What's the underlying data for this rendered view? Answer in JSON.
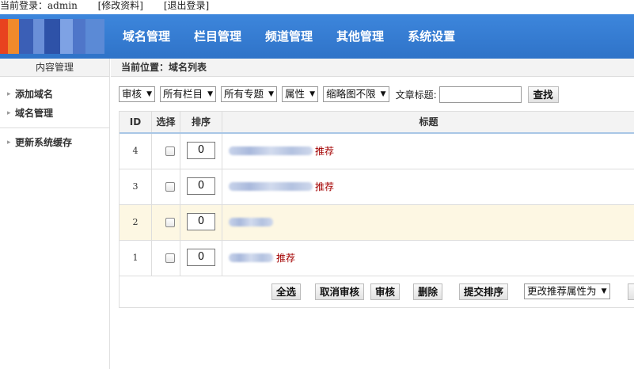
{
  "topbar": {
    "login_label": "当前登录：",
    "username": "admin",
    "edit_profile": "[修改资料]",
    "logout": "[退出登录]"
  },
  "nav": [
    {
      "label": "域名管理"
    },
    {
      "label": "栏目管理"
    },
    {
      "label": "频道管理"
    },
    {
      "label": "其他管理"
    },
    {
      "label": "系统设置"
    }
  ],
  "sidebar": {
    "title": "内容管理",
    "items": [
      {
        "label": "添加域名"
      },
      {
        "label": "域名管理"
      },
      {
        "label": "更新系统缓存"
      }
    ]
  },
  "breadcrumb": {
    "label": "当前位置：",
    "current": "域名列表"
  },
  "filters": {
    "status": "审核",
    "category": "所有栏目",
    "topic": "所有专题",
    "attribute": "属性",
    "thumbnail": "缩略图不限",
    "title_label": "文章标题:",
    "search_value": "",
    "search_button": "查找"
  },
  "table": {
    "headers": {
      "id": "ID",
      "select": "选择",
      "order": "排序",
      "title": "标题"
    },
    "rows": [
      {
        "id": "4",
        "order": "0",
        "tag": "推荐"
      },
      {
        "id": "3",
        "order": "0",
        "tag": "推荐"
      },
      {
        "id": "2",
        "order": "0",
        "tag": ""
      },
      {
        "id": "1",
        "order": "0",
        "tag": "推荐"
      }
    ]
  },
  "actions": {
    "select_all": "全选",
    "cancel_review": "取消审核",
    "review": "审核",
    "delete": "删除",
    "submit_order": "提交排序",
    "change_recommend": "更改推荐属性为"
  },
  "colors": {
    "header_blue": "#3d86dc",
    "recommend_red": "#a30000",
    "highlight_row": "#fdf7e3"
  }
}
